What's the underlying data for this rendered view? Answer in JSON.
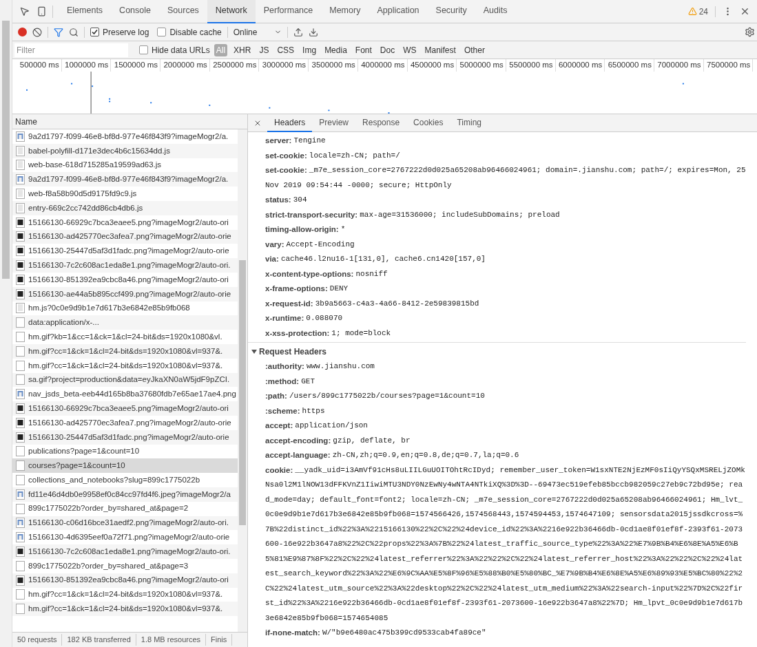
{
  "main_tabs": [
    {
      "label": "Elements",
      "selected": false
    },
    {
      "label": "Console",
      "selected": false
    },
    {
      "label": "Sources",
      "selected": false
    },
    {
      "label": "Network",
      "selected": true
    },
    {
      "label": "Performance",
      "selected": false
    },
    {
      "label": "Memory",
      "selected": false
    },
    {
      "label": "Application",
      "selected": false
    },
    {
      "label": "Security",
      "selected": false
    },
    {
      "label": "Audits",
      "selected": false
    }
  ],
  "warning_count": "24",
  "toolbar": {
    "recording": true,
    "filter_on": true,
    "preserve_log": {
      "label": "Preserve log",
      "checked": true
    },
    "disable_cache": {
      "label": "Disable cache",
      "checked": false
    },
    "throttling": "Online"
  },
  "filter_bar": {
    "placeholder": "Filter",
    "hide_data_urls": {
      "label": "Hide data URLs",
      "checked": false
    },
    "types": [
      {
        "label": "All",
        "selected": true
      },
      {
        "label": "XHR",
        "selected": false
      },
      {
        "label": "JS",
        "selected": false
      },
      {
        "label": "CSS",
        "selected": false
      },
      {
        "label": "Img",
        "selected": false
      },
      {
        "label": "Media",
        "selected": false
      },
      {
        "label": "Font",
        "selected": false
      },
      {
        "label": "Doc",
        "selected": false
      },
      {
        "label": "WS",
        "selected": false
      },
      {
        "label": "Manifest",
        "selected": false
      },
      {
        "label": "Other",
        "selected": false
      }
    ]
  },
  "timeline": {
    "ticks": [
      "500000 ms",
      "1000000 ms",
      "1500000 ms",
      "2000000 ms",
      "2500000 ms",
      "3000000 ms",
      "3500000 ms",
      "4000000 ms",
      "4500000 ms",
      "5000000 ms",
      "5500000 ms",
      "6000000 ms",
      "6500000 ms",
      "7000000 ms",
      "7500000 ms"
    ]
  },
  "requests": {
    "column": "Name",
    "rows": [
      {
        "name": "9a2d1797-f099-46e8-bf8d-977e46f843f9?imageMogr2/a.",
        "kind": "photo",
        "selected": false
      },
      {
        "name": "babel-polyfill-d171e3dec4b6c15634dd.js",
        "kind": "script",
        "selected": false
      },
      {
        "name": "web-base-618d715285a19599ad63.js",
        "kind": "script",
        "selected": false
      },
      {
        "name": "9a2d1797-f099-46e8-bf8d-977e46f843f9?imageMogr2/a.",
        "kind": "photo",
        "selected": false
      },
      {
        "name": "web-f8a58b90d5d9175fd9c9.js",
        "kind": "script",
        "selected": false
      },
      {
        "name": "entry-669c2cc742dd86cb4db6.js",
        "kind": "script",
        "selected": false
      },
      {
        "name": "15166130-66929c7bca3eaee5.png?imageMogr2/auto-ori",
        "kind": "image",
        "selected": false
      },
      {
        "name": "15166130-ad425770ec3afea7.png?imageMogr2/auto-orie",
        "kind": "image",
        "selected": false
      },
      {
        "name": "15166130-25447d5af3d1fadc.png?imageMogr2/auto-orie",
        "kind": "image",
        "selected": false
      },
      {
        "name": "15166130-7c2c608ac1eda8e1.png?imageMogr2/auto-ori.",
        "kind": "image",
        "selected": false
      },
      {
        "name": "15166130-851392ea9cbc8a46.png?imageMogr2/auto-ori",
        "kind": "image",
        "selected": false
      },
      {
        "name": "15166130-ae44a5b895ccf499.png?imageMogr2/auto-orie",
        "kind": "image",
        "selected": false
      },
      {
        "name": "hm.js?0c0e9d9b1e7d617b3e6842e85b9fb068",
        "kind": "script",
        "selected": false
      },
      {
        "name": "data:application/x-...",
        "kind": "blank",
        "selected": false
      },
      {
        "name": "hm.gif?kb=1&cc=1&ck=1&cl=24-bit&ds=1920x1080&vl.",
        "kind": "blank",
        "selected": false
      },
      {
        "name": "hm.gif?cc=1&ck=1&cl=24-bit&ds=1920x1080&vl=937&.",
        "kind": "blank",
        "selected": false
      },
      {
        "name": "hm.gif?cc=1&ck=1&cl=24-bit&ds=1920x1080&vl=937&.",
        "kind": "blank",
        "selected": false
      },
      {
        "name": "sa.gif?project=production&data=eyJkaXN0aW5jdF9pZCI.",
        "kind": "blank",
        "selected": false
      },
      {
        "name": "nav_jsds_beta-eeb44d165b8ba37680fdb7e65ae17ae4.png",
        "kind": "photo",
        "selected": false
      },
      {
        "name": "15166130-66929c7bca3eaee5.png?imageMogr2/auto-ori",
        "kind": "image",
        "selected": false
      },
      {
        "name": "15166130-ad425770ec3afea7.png?imageMogr2/auto-orie",
        "kind": "image",
        "selected": false
      },
      {
        "name": "15166130-25447d5af3d1fadc.png?imageMogr2/auto-orie",
        "kind": "image",
        "selected": false
      },
      {
        "name": "publications?page=1&count=10",
        "kind": "blank",
        "selected": false
      },
      {
        "name": "courses?page=1&count=10",
        "kind": "blank",
        "selected": true
      },
      {
        "name": "collections_and_notebooks?slug=899c1775022b",
        "kind": "blank",
        "selected": false
      },
      {
        "name": "fd11e46d4db0e9958ef0c84cc97fd4f6.jpeg?imageMogr2/a",
        "kind": "photo",
        "selected": false
      },
      {
        "name": "899c1775022b?order_by=shared_at&page=2",
        "kind": "blank",
        "selected": false
      },
      {
        "name": "15166130-c06d16bce31aedf2.png?imageMogr2/auto-ori.",
        "kind": "photo",
        "selected": false
      },
      {
        "name": "15166130-4d6395eef0a72f71.png?imageMogr2/auto-orie",
        "kind": "photo",
        "selected": false
      },
      {
        "name": "15166130-7c2c608ac1eda8e1.png?imageMogr2/auto-ori.",
        "kind": "image",
        "selected": false
      },
      {
        "name": "899c1775022b?order_by=shared_at&page=3",
        "kind": "blank",
        "selected": false
      },
      {
        "name": "15166130-851392ea9cbc8a46.png?imageMogr2/auto-ori",
        "kind": "image",
        "selected": false
      },
      {
        "name": "hm.gif?cc=1&ck=1&cl=24-bit&ds=1920x1080&vl=937&.",
        "kind": "blank",
        "selected": false
      },
      {
        "name": "hm.gif?cc=1&ck=1&cl=24-bit&ds=1920x1080&vl=937&.",
        "kind": "blank",
        "selected": false
      }
    ]
  },
  "status_bar": [
    "50 requests",
    "182 KB transferred",
    "1.8 MB resources",
    "Finis"
  ],
  "detail_tabs": [
    {
      "label": "Headers",
      "selected": true
    },
    {
      "label": "Preview",
      "selected": false
    },
    {
      "label": "Response",
      "selected": false
    },
    {
      "label": "Cookies",
      "selected": false
    },
    {
      "label": "Timing",
      "selected": false
    }
  ],
  "response_headers": [
    {
      "name": "server:",
      "value": "Tengine"
    },
    {
      "name": "set-cookie:",
      "value": "locale=zh-CN; path=/"
    },
    {
      "name": "set-cookie:",
      "value": "_m7e_session_core=2767222d0d025a65208ab96466024961; domain=.jianshu.com; path=/; expires=Mon, 25 Nov 2019 09:54:44 -0000; secure; HttpOnly"
    },
    {
      "name": "status:",
      "value": "304"
    },
    {
      "name": "strict-transport-security:",
      "value": "max-age=31536000; includeSubDomains; preload"
    },
    {
      "name": "timing-allow-origin:",
      "value": "*"
    },
    {
      "name": "vary:",
      "value": "Accept-Encoding"
    },
    {
      "name": "via:",
      "value": "cache46.l2nu16-1[131,0], cache6.cn1420[157,0]"
    },
    {
      "name": "x-content-type-options:",
      "value": "nosniff"
    },
    {
      "name": "x-frame-options:",
      "value": "DENY"
    },
    {
      "name": "x-request-id:",
      "value": "3b9a5663-c4a3-4a66-8412-2e59839815bd"
    },
    {
      "name": "x-runtime:",
      "value": "0.088070"
    },
    {
      "name": "x-xss-protection:",
      "value": "1; mode=block"
    }
  ],
  "request_headers": {
    "title": "Request Headers",
    "expanded": true,
    "headers": [
      {
        "name": ":authority:",
        "value": "www.jianshu.com"
      },
      {
        "name": ":method:",
        "value": "GET"
      },
      {
        "name": ":path:",
        "value": "/users/899c1775022b/courses?page=1&count=10"
      },
      {
        "name": ":scheme:",
        "value": "https"
      },
      {
        "name": "accept:",
        "value": "application/json"
      },
      {
        "name": "accept-encoding:",
        "value": "gzip, deflate, br"
      },
      {
        "name": "accept-language:",
        "value": "zh-CN,zh;q=0.9,en;q=0.8,de;q=0.7,la;q=0.6"
      },
      {
        "name": "cookie:",
        "value": "__yadk_uid=i3AmVf91cHs8uLIILGuUOITOhtRcIDyd; remember_user_token=W1sxNTE2NjEzMF0sIiQyYSQxMSRELjZOMkNsa0l2M1lNOW13dFFKVnZ1IiwiMTU3NDY0NzEwNy4wNTA4NTkiXQ%3D%3D--69473ec519efeb85bccb982059c27eb9c72bd95e; read_mode=day; default_font=font2; locale=zh-CN; _m7e_session_core=2767222d0d025a65208ab96466024961; Hm_lvt_0c0e9d9b1e7d617b3e6842e85b9fb068=1574566426,1574568443,1574594453,1574647109; sensorsdata2015jssdkcross=%7B%22distinct_id%22%3A%2215166130%22%2C%22%24device_id%22%3A%2216e922b36466db-0cd1ae8f01ef8f-2393f61-2073600-16e922b3647a8%22%2C%22props%22%3A%7B%22%24latest_traffic_source_type%22%3A%22%E7%9B%B4%E6%8E%A5%E6%B5%81%E9%87%8F%22%2C%22%24latest_referrer%22%3A%22%22%2C%22%24latest_referrer_host%22%3A%22%22%2C%22%24latest_search_keyword%22%3A%22%E6%9C%AA%E5%8F%96%E5%88%B0%E5%80%BC_%E7%9B%B4%E6%8E%A5%E6%89%93%E5%BC%80%22%2C%22%24latest_utm_source%22%3A%22desktop%22%2C%22%24latest_utm_medium%22%3A%22search-input%22%7D%2C%22first_id%22%3A%2216e922b36466db-0cd1ae8f01ef8f-2393f61-2073600-16e922b3647a8%22%7D; Hm_lpvt_0c0e9d9b1e7d617b3e6842e85b9fb068=1574654085"
      },
      {
        "name": "if-none-match:",
        "value": "W/\"b9e6480ac475b399cd9533cab4fa89ce\""
      }
    ]
  }
}
